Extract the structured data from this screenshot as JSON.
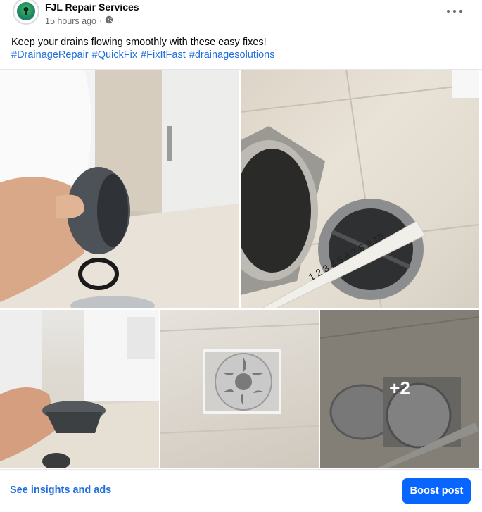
{
  "post": {
    "page_name": "FJL Repair Services",
    "timestamp": "15 hours ago",
    "separator": "·",
    "privacy_icon": "globe-icon",
    "more_icon": "more-options-icon",
    "text": "Keep your drains flowing smoothly with these easy fixes!",
    "hashtags": [
      "#DrainageRepair",
      "#QuickFix",
      "#FixItFast",
      "#drainagesolutions"
    ]
  },
  "photos": {
    "more_count": "+2",
    "ruler_numbers": "1 2 3 4 5 6 7 8 9 10"
  },
  "footer": {
    "insights_label": "See insights and ads",
    "boost_label": "Boost post"
  },
  "colors": {
    "link": "#216fdb",
    "boost_button": "#0866ff",
    "meta_text": "#65676b"
  }
}
